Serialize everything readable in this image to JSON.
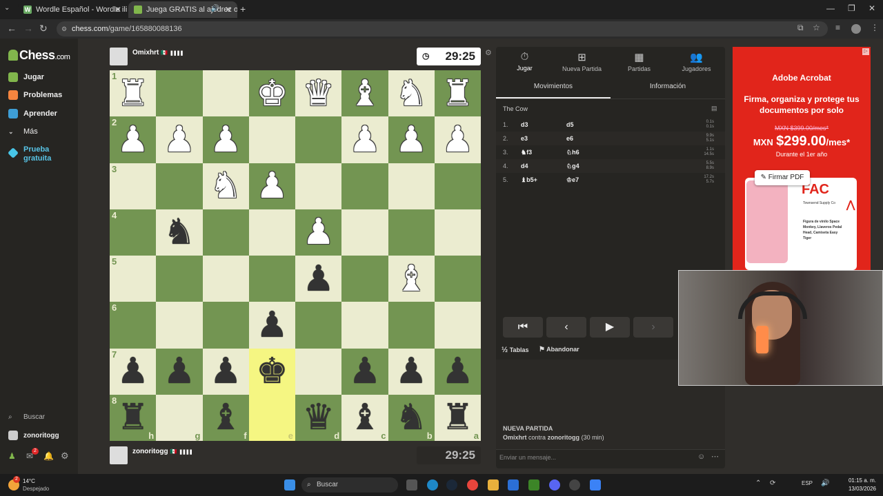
{
  "browser": {
    "tabs": [
      {
        "title": "Wordle Español - Wordle ilimit",
        "icon": "W"
      },
      {
        "title": "Juega GRATIS al ajedrez on"
      }
    ],
    "url_host": "chess.com",
    "url_path": "/game/165880088136"
  },
  "sidebar": {
    "logo": "Chess",
    "logo_suffix": ".com",
    "items": [
      {
        "label": "Jugar",
        "icon": "play-icon"
      },
      {
        "label": "Problemas",
        "icon": "puzzle-icon"
      },
      {
        "label": "Aprender",
        "icon": "learn-icon"
      },
      {
        "label": "Más",
        "icon": "chevron-down-icon"
      },
      {
        "label": "Prueba gratuita",
        "icon": "diamond-icon"
      }
    ],
    "search": "Buscar",
    "user": "zonoritogg",
    "mail_badge": "2"
  },
  "top_player": {
    "name": "Omixhrt",
    "flag": "🇲🇽",
    "clock": "29:25"
  },
  "bottom_player": {
    "name": "zonoritogg",
    "flag": "🇲🇽",
    "clock": "29:25"
  },
  "board": {
    "ranks": [
      "1",
      "2",
      "3",
      "4",
      "5",
      "6",
      "7",
      "8"
    ],
    "files": [
      "h",
      "g",
      "f",
      "e",
      "d",
      "c",
      "b",
      "a"
    ],
    "rows": [
      [
        "♜",
        "",
        "",
        "♚",
        "♛",
        "♝",
        "♞",
        "♜"
      ],
      [
        "♟",
        "♟",
        "♟",
        "",
        "",
        "♟",
        "♟",
        "♟"
      ],
      [
        "",
        "",
        "♞",
        "♟",
        "",
        "",
        "",
        ""
      ],
      [
        "",
        "♞",
        "",
        "",
        "♟",
        "",
        "",
        ""
      ],
      [
        "",
        "",
        "",
        "",
        "♟",
        "",
        "♝",
        ""
      ],
      [
        "",
        "",
        "",
        "♟",
        "",
        "",
        "",
        ""
      ],
      [
        "♟",
        "♟",
        "♟",
        "♚",
        "",
        "♟",
        "♟",
        "♟"
      ],
      [
        "♜",
        "",
        "♝",
        "",
        "♛",
        "♝",
        "♞",
        "♜"
      ]
    ],
    "colors": [
      [
        "w",
        "",
        "",
        "w",
        "w",
        "w",
        "w",
        "w"
      ],
      [
        "w",
        "w",
        "w",
        "",
        "",
        "w",
        "w",
        "w"
      ],
      [
        "",
        "",
        "w",
        "w",
        "",
        "",
        "",
        ""
      ],
      [
        "",
        "b",
        "",
        "",
        "w",
        "",
        "",
        ""
      ],
      [
        "",
        "",
        "",
        "",
        "b",
        "",
        "w",
        ""
      ],
      [
        "",
        "",
        "",
        "b",
        "",
        "",
        "",
        ""
      ],
      [
        "b",
        "b",
        "b",
        "b",
        "",
        "b",
        "b",
        "b"
      ],
      [
        "b",
        "",
        "b",
        "",
        "b",
        "b",
        "b",
        "b"
      ]
    ],
    "highlight": [
      [
        6,
        3
      ],
      [
        7,
        3
      ]
    ]
  },
  "panel": {
    "tabs": [
      {
        "label": "Jugar",
        "icon": "clock-icon"
      },
      {
        "label": "Nueva Partida",
        "icon": "plus-icon"
      },
      {
        "label": "Partidas",
        "icon": "board-icon"
      },
      {
        "label": "Jugadores",
        "icon": "players-icon"
      }
    ],
    "subtabs": [
      "Movimientos",
      "Información"
    ],
    "opening": "The Cow",
    "moves": [
      {
        "n": "1.",
        "w": "d3",
        "b": "d5",
        "t1": "0.1s",
        "t2": "0.1s"
      },
      {
        "n": "2.",
        "w": "e3",
        "b": "e6",
        "t1": "9.9s",
        "t2": "5.1s"
      },
      {
        "n": "3.",
        "w": "♞f3",
        "b": "♘h6",
        "t1": "1.1s",
        "t2": "14.5s"
      },
      {
        "n": "4.",
        "w": "d4",
        "b": "♘g4",
        "t1": "5.5s",
        "t2": "8.9s"
      },
      {
        "n": "5.",
        "w": "♝b5+",
        "b": "♔e7",
        "t1": "17.2s",
        "t2": "5.7s"
      }
    ],
    "draw": "Tablas",
    "draw_prefix": "½",
    "resign": "Abandonar",
    "new_game_title": "NUEVA PARTIDA",
    "new_game_p1": "Omixhrt",
    "new_game_vs": "contra",
    "new_game_p2": "zonoritogg",
    "new_game_time": "(30 min)",
    "chat_placeholder": "Enviar un mensaje..."
  },
  "ad": {
    "brand": "Adobe Acrobat",
    "headline": "Firma, organiza y protege tus documentos por solo",
    "old_price": "MXN $399.00/mes*",
    "currency": "MXN",
    "price": "$299.00",
    "per": "/mes*",
    "period": "Durante el 1er año",
    "cta": "Firmar PDF",
    "doc_title": "FAC",
    "doc_company": "Townsend Supply Co",
    "doc_items": "Figura de vinilo Space Monkey, Llaveros Pedal Head, Camiseta Easy Tiger"
  },
  "taskbar": {
    "temp": "14°C",
    "weather": "Despejado",
    "search": "Buscar",
    "lang": "ESP",
    "time": "01:15 a. m.",
    "date": "13/03/2026",
    "weather_badge": "2"
  }
}
